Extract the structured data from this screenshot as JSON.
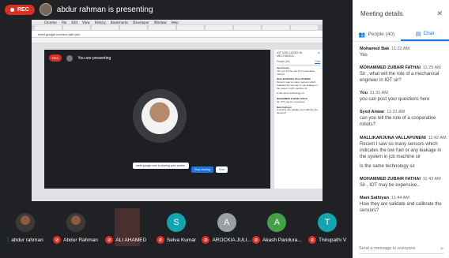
{
  "top_bar": {
    "rec_label": "REC",
    "presenting_text": "abdur rahman is presenting"
  },
  "shared_screen": {
    "mac_menu": [
      "",
      "Chrome",
      "File",
      "Edit",
      "View",
      "History",
      "Bookmarks",
      "Developer",
      "Window",
      "Help"
    ],
    "tabs": [
      "",
      "",
      "",
      "",
      "",
      "",
      "",
      "",
      "",
      ""
    ],
    "address": "meet.google.com/rnx-iqfn-wzc",
    "inner_meet": {
      "rec_label": "REC",
      "presenting_text": "You are presenting",
      "share_message": "meet.google.com is sharing your screen.",
      "stop_label": "Stop sharing",
      "hide_label": "Hide"
    },
    "inner_panel": {
      "title": "IOT USE CASES IN MECHANICA...",
      "tab_people": "People (40)",
      "tab_chat": "Chat",
      "messages": [
        {
          "author": "Syed Anwar",
          "text": "can you tell the role of a cooperative robots?"
        },
        {
          "author": "MALLIKARJUNA VALLAPUNENI",
          "text": "Recent I saw so many sensors which indicates the low fuel or any leakage in the system in jcb machine sir"
        },
        {
          "author": "",
          "text": "Is the same technology sir"
        },
        {
          "author": "MOHAMMED ZUBAIR FATHAI",
          "text": "Sir, IOT may be expensive.."
        },
        {
          "author": "Mani Sathiyan",
          "text": "How they are validate and calibrate the sensors?"
        }
      ]
    }
  },
  "dock_colors": [
    "#2b5fa8",
    "#d04a3a",
    "#6a6a6a",
    "#e0672b",
    "#c94b4b",
    "#3a3a3a",
    "#2f8f3e",
    "#4a88d8",
    "#6fb3e8",
    "#8a8a8a",
    "#3a6ea5",
    "#3a8a5a",
    "#4e8fcf",
    "#e0e0e0",
    "#dcdcdc",
    "#e8e8e8",
    "#6e6e6e"
  ],
  "participants": [
    {
      "name": "abdur rahman",
      "initial": "",
      "photo": true,
      "muted": false,
      "bg": ""
    },
    {
      "name": "Abdur Rahman",
      "initial": "",
      "photo": true,
      "muted": true,
      "bg": ""
    },
    {
      "name": "ALI AHAMED",
      "initial": "",
      "photo": false,
      "muted": true,
      "bg": "#4a2f2f"
    },
    {
      "name": "Selva Kumar",
      "initial": "S",
      "photo": false,
      "muted": true,
      "bg": "#12a4af"
    },
    {
      "name": "AROCKIA JULI...",
      "initial": "A",
      "photo": false,
      "muted": true,
      "bg": "#9aa0a6"
    },
    {
      "name": "Akash Pandura...",
      "initial": "A",
      "photo": false,
      "muted": true,
      "bg": "#43a047"
    },
    {
      "name": "Thirupathi V",
      "initial": "T",
      "photo": false,
      "muted": true,
      "bg": "#12a4af"
    }
  ],
  "panel": {
    "title": "Meeting details",
    "tab_people": "People (40)",
    "tab_chat": "Chat",
    "messages": [
      {
        "author": "Mohamed Bak",
        "time": "11:22 AM",
        "texts": [
          "Yes"
        ]
      },
      {
        "author": "MOHAMMED ZUBAIR FATHAI",
        "time": "11:29 AM",
        "texts": [
          "Sir , what will the role of a mechanical engineer in IOT sir?"
        ]
      },
      {
        "author": "You",
        "time": "11:31 AM",
        "texts": [
          "you can post your questions here"
        ]
      },
      {
        "author": "Syed Anwar",
        "time": "11:31 AM",
        "texts": [
          "can you tell the role of a cooperative robots?"
        ]
      },
      {
        "author": "MALLIKARJUNA VALLAPUNENI",
        "time": "11:42 AM",
        "texts": [
          "Recent I saw so many sensors which indicates the low fuel or any leakage in the system in jcb machine sir",
          "Is the same technology sir"
        ]
      },
      {
        "author": "MOHAMMED ZUBAIR FATHAI",
        "time": "11:43 AM",
        "texts": [
          "Sir , IOT may be expensive.."
        ]
      },
      {
        "author": "Mani Sathiyan",
        "time": "11:44 AM",
        "texts": [
          "How they are validate and calibrate the sensors?"
        ]
      }
    ],
    "composer_placeholder": "Send a message to everyone"
  }
}
